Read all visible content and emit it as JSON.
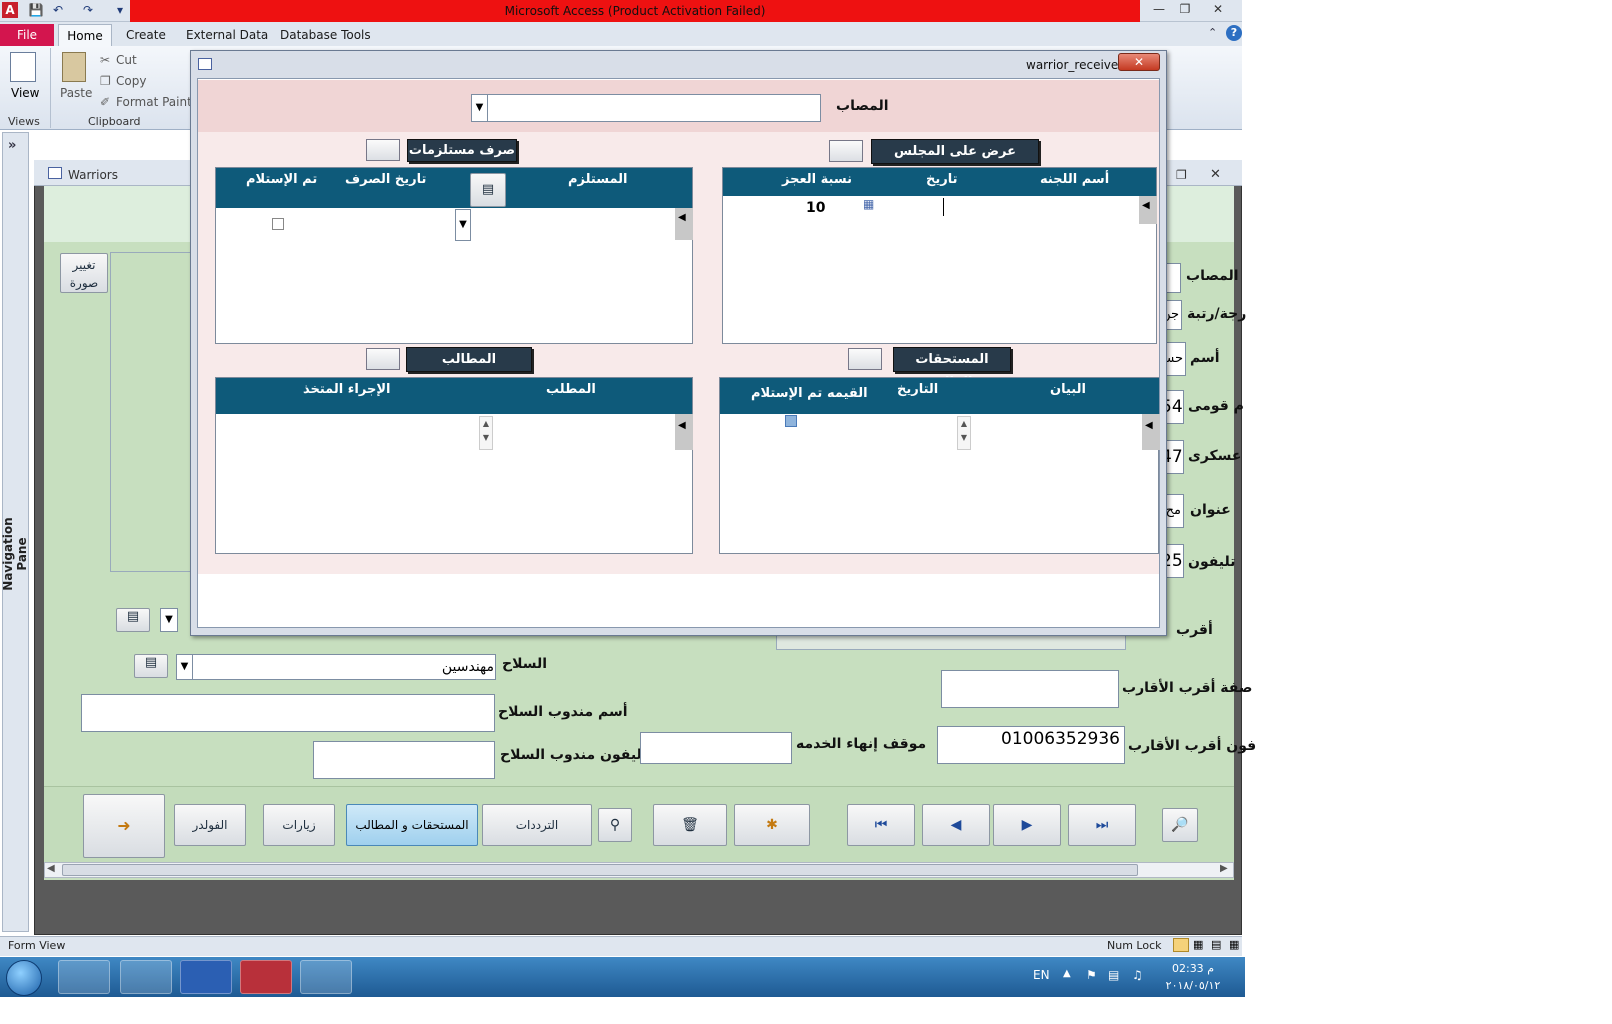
{
  "window": {
    "title": "Microsoft Access (Product Activation Failed)"
  },
  "ribbon": {
    "tabs": [
      "File",
      "Home",
      "Create",
      "External Data",
      "Database Tools"
    ],
    "view_label": "View",
    "views_group": "Views",
    "paste_label": "Paste",
    "cut_label": "Cut",
    "copy_label": "Copy",
    "format_painter_label": "Format Painter",
    "clipboard_group": "Clipboard"
  },
  "nav_pane": {
    "label": "Navigation Pane"
  },
  "warriors": {
    "title": "Warriors",
    "change_photo": "تغيير صورة",
    "labels": {
      "injured": "المصاب",
      "rank": "رجة/رتبة",
      "name": "أسم",
      "national_id": "م قومى",
      "military": "عسكرى",
      "address": "عنوان",
      "phone": "تليفون",
      "kin": "أقرب",
      "weapon": "السلاح",
      "weapon_rep_name": "أسم مندوب السلاح",
      "weapon_rep_phone": "تليفون مندوب السلاح",
      "service_end": "موقف إنهاء الخدمه",
      "kin_relation": "صفة أقرب الأقارب",
      "kin_phone": "فون أقرب الأقارب"
    },
    "values": {
      "rank_partial": "جن",
      "name_partial": "حس",
      "national_partial": "54",
      "military_partial": "47",
      "address_partial": "مح",
      "phone_partial": "25",
      "weapon": "مهندسين",
      "kin_phone": "01006352936"
    },
    "buttons": {
      "folder": "الفولدر",
      "visits": "زيارات",
      "dues_requests": "المستحقات و المطالب",
      "visits_freq": "الترددات"
    }
  },
  "popup": {
    "title": "warrior_receivers",
    "injured_label": "المصاب",
    "medical_btn": "عرض على المجلس الطبى",
    "supplies_btn": "صرف مستلزمات",
    "financial_btn": "المستحقات الماليه",
    "requests_btn": "المطالب",
    "committee": {
      "headers": [
        "أسم اللجنه",
        "تاريخ",
        "نسبة العجز"
      ],
      "row_value": "10"
    },
    "supplies": {
      "headers": [
        "المستلزم",
        "تاريخ الصرف",
        "تم الإستلام"
      ]
    },
    "financial": {
      "headers": [
        "البيان",
        "التاريخ",
        "القيمه",
        "تم الإستلام"
      ]
    },
    "requests": {
      "headers": [
        "المطلب",
        "الإجراء المتخذ"
      ]
    }
  },
  "statusbar": {
    "left": "Form View",
    "numlock": "Num Lock"
  },
  "taskbar": {
    "lang": "EN",
    "time": "02:33 م",
    "date": "٢٠١٨/٠٥/١٢"
  }
}
